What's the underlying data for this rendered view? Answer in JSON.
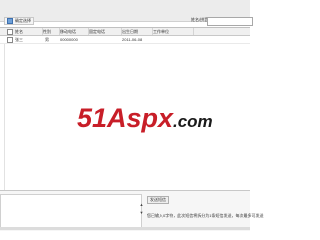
{
  "toolbar": {
    "select_button_label": "确定选择",
    "search_label": "姓名/拼音",
    "search_value": ""
  },
  "grid": {
    "headers": [
      "姓名",
      "性别",
      "移动电话",
      "固定电话",
      "出生日期",
      "工作单位"
    ],
    "rows": [
      {
        "cells": [
          "张三",
          "男",
          "00000000",
          "",
          "2011-06-08",
          ""
        ]
      }
    ]
  },
  "watermark": {
    "text": "51Aspx",
    "suffix": ".com",
    "colors": {
      "primary": "#c81e28",
      "secondary": "#1a1a1a"
    }
  },
  "bottom": {
    "textarea_value": "",
    "send_button_label": "发送短信",
    "hint": "您已输入0字符，此次短信将拆分为1条短信发送，每次最多可发送"
  }
}
